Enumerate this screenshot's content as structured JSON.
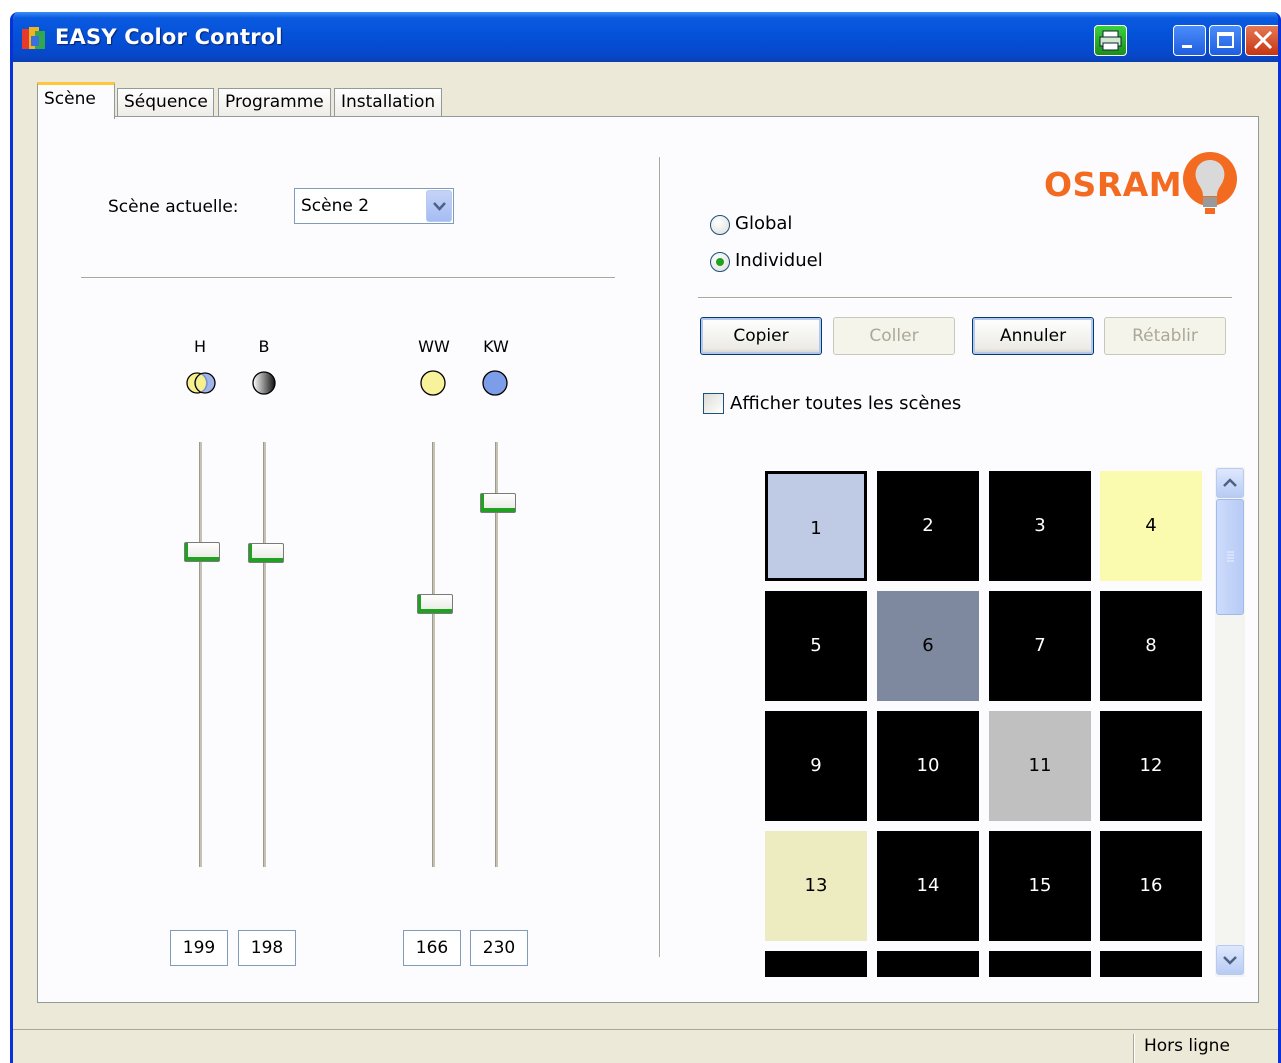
{
  "window": {
    "title": "EASY Color Control"
  },
  "tabs": [
    {
      "label": "Scène",
      "active": true
    },
    {
      "label": "Séquence",
      "active": false
    },
    {
      "label": "Programme",
      "active": false
    },
    {
      "label": "Installation",
      "active": false
    }
  ],
  "scene_selector": {
    "label": "Scène actuelle:",
    "value": "Scène 2"
  },
  "sliders": [
    {
      "label": "H",
      "icon": "hue-icon",
      "value": "199",
      "level": 0.78
    },
    {
      "label": "B",
      "icon": "brightness-icon",
      "value": "198",
      "level": 0.78
    },
    {
      "label": "WW",
      "icon": "warm-white-icon",
      "value": "166",
      "level": 0.65
    },
    {
      "label": "KW",
      "icon": "cold-white-icon",
      "value": "230",
      "level": 0.9
    }
  ],
  "brand": {
    "name": "OSRAM",
    "color": "#f36b21"
  },
  "mode": {
    "options": [
      {
        "label": "Global",
        "checked": false
      },
      {
        "label": "Individuel",
        "checked": true
      }
    ]
  },
  "actions": {
    "copy": "Copier",
    "paste": "Coller",
    "undo": "Annuler",
    "redo": "Rétablir"
  },
  "show_all_scenes": {
    "label": "Afficher toutes les scènes",
    "checked": false
  },
  "scenes": [
    {
      "n": "1",
      "color": "#bfcbe4",
      "selected": true
    },
    {
      "n": "2",
      "color": "#000000"
    },
    {
      "n": "3",
      "color": "#000000"
    },
    {
      "n": "4",
      "color": "#fbfbb0"
    },
    {
      "n": "5",
      "color": "#000000"
    },
    {
      "n": "6",
      "color": "#7e889e"
    },
    {
      "n": "7",
      "color": "#000000"
    },
    {
      "n": "8",
      "color": "#000000"
    },
    {
      "n": "9",
      "color": "#000000"
    },
    {
      "n": "10",
      "color": "#000000"
    },
    {
      "n": "11",
      "color": "#c0c0c0"
    },
    {
      "n": "12",
      "color": "#000000"
    },
    {
      "n": "13",
      "color": "#ececc0"
    },
    {
      "n": "14",
      "color": "#000000"
    },
    {
      "n": "15",
      "color": "#000000"
    },
    {
      "n": "16",
      "color": "#000000"
    },
    {
      "n": "",
      "color": "#000000"
    },
    {
      "n": "",
      "color": "#000000"
    },
    {
      "n": "",
      "color": "#000000"
    },
    {
      "n": "",
      "color": "#000000"
    }
  ],
  "status": {
    "text": "Hors ligne"
  }
}
